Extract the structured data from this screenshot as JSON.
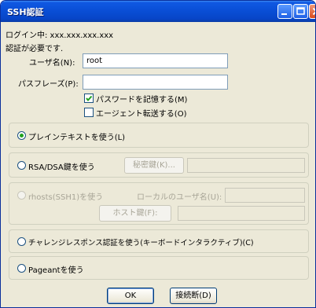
{
  "window": {
    "title": "SSH認証",
    "min_icon": "minimize-icon",
    "max_icon": "maximize-icon",
    "close_icon": "close-icon"
  },
  "status": {
    "logging_in": "ログイン中: xxx.xxx.xxx.xxx",
    "auth_required": "認証が必要です."
  },
  "form": {
    "username_label": "ユーザ名(N):",
    "username_value": "root",
    "passphrase_label": "パスフレーズ(P):",
    "passphrase_value": "",
    "remember_password_label": "パスワードを記憶する(M)",
    "remember_password_checked": true,
    "agent_forward_label": "エージェント転送する(O)",
    "agent_forward_checked": false
  },
  "methods": {
    "plaintext_label": "プレインテキストを使う(L)",
    "rsa_label": "RSA/DSA鍵を使う",
    "private_key_button": "秘密鍵(K)...",
    "private_key_value": "",
    "rhosts_label": "rhosts(SSH1)を使う",
    "local_user_label": "ローカルのユーザ名(U):",
    "local_user_value": "",
    "host_key_button": "ホスト鍵(F):",
    "host_key_value": "",
    "challenge_label": "チャレンジレスポンス認証を使う(キーボードインタラクティブ)(C)",
    "pageant_label": "Pageantを使う",
    "selected": "plaintext"
  },
  "buttons": {
    "ok": "OK",
    "disconnect": "接続断(D)"
  },
  "colors": {
    "titlebar": "#0a50d8",
    "dialog_bg": "#ece9d8",
    "radio_dot": "#21a121"
  }
}
